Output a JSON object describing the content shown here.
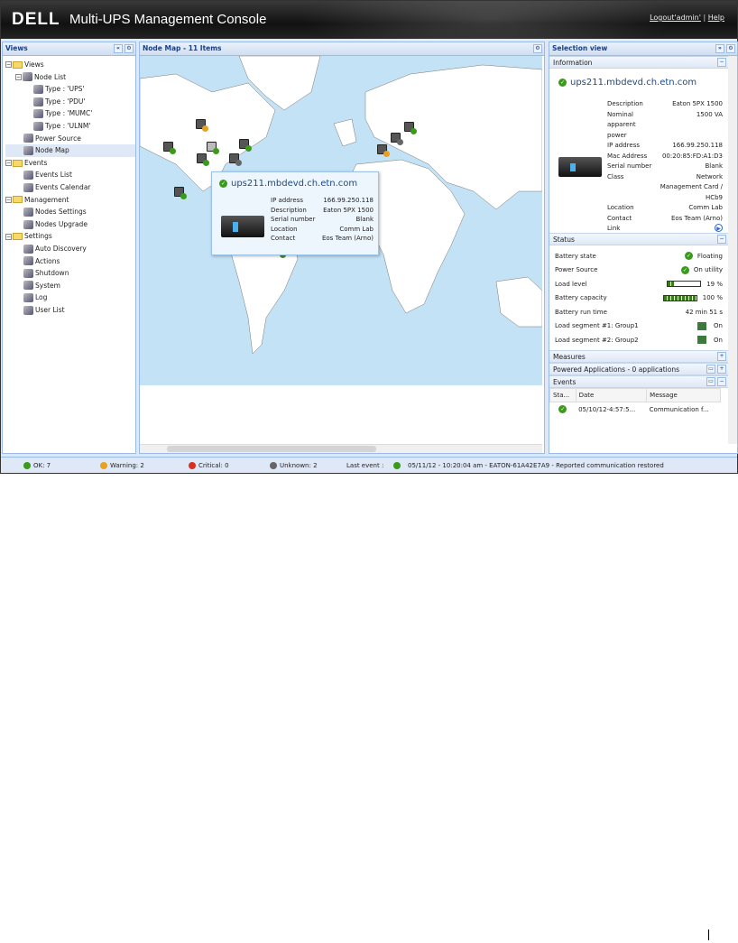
{
  "header": {
    "logo": "DELL",
    "title": "Multi-UPS Management Console",
    "logout": "Logout'admin'",
    "sep": "|",
    "help": "Help"
  },
  "views": {
    "title": "Views",
    "items": [
      {
        "label": "Views",
        "level": 0,
        "type": "folder"
      },
      {
        "label": "Node List",
        "level": 1,
        "type": "list"
      },
      {
        "label": "Type : 'UPS'",
        "level": 2
      },
      {
        "label": "Type : 'PDU'",
        "level": 2
      },
      {
        "label": "Type : 'MUMC'",
        "level": 2
      },
      {
        "label": "Type : 'ULNM'",
        "level": 2
      },
      {
        "label": "Power Source",
        "level": 1
      },
      {
        "label": "Node Map",
        "level": 1,
        "selected": true
      },
      {
        "label": "Events",
        "level": 0,
        "type": "folder"
      },
      {
        "label": "Events List",
        "level": 1
      },
      {
        "label": "Events Calendar",
        "level": 1
      },
      {
        "label": "Management",
        "level": 0,
        "type": "folder"
      },
      {
        "label": "Nodes Settings",
        "level": 1
      },
      {
        "label": "Nodes Upgrade",
        "level": 1
      },
      {
        "label": "Settings",
        "level": 0,
        "type": "folder"
      },
      {
        "label": "Auto Discovery",
        "level": 1
      },
      {
        "label": "Actions",
        "level": 1
      },
      {
        "label": "Shutdown",
        "level": 1
      },
      {
        "label": "System",
        "level": 1
      },
      {
        "label": "Log",
        "level": 1
      },
      {
        "label": "User List",
        "level": 1
      }
    ]
  },
  "map": {
    "title": "Node Map - 11 Items",
    "tooltip": {
      "host": "ups211.mbdevd.ch.etn.com",
      "fields": [
        [
          "IP address",
          "166.99.250.118"
        ],
        [
          "Description",
          "Eaton 5PX 1500"
        ],
        [
          "Serial number",
          "Blank"
        ],
        [
          "Location",
          "Comm Lab"
        ],
        [
          "Contact",
          "Eos Team (Arno)"
        ]
      ]
    }
  },
  "selection": {
    "title": "Selection view",
    "information": {
      "title": "Information",
      "host": "ups211.mbdevd.ch.etn.com",
      "fields": [
        [
          "Description",
          "Eaton 5PX 1500"
        ],
        [
          "Nominal apparent power",
          "1500 VA"
        ],
        [
          "IP address",
          "166.99.250.118"
        ],
        [
          "Mac Address",
          "00:20:85:FD:A1:D3"
        ],
        [
          "Serial number",
          "Blank"
        ],
        [
          "Class",
          "Network Management Card / HCb9"
        ],
        [
          "Location",
          "Comm Lab"
        ],
        [
          "Contact",
          "Eos Team (Arno)"
        ],
        [
          "Link",
          ""
        ]
      ]
    },
    "status": {
      "title": "Status",
      "rows": [
        {
          "label": "Battery state",
          "value": "Floating",
          "icon": "ok"
        },
        {
          "label": "Power Source",
          "value": "On utility",
          "icon": "ok"
        },
        {
          "label": "Load level",
          "value": "19 %",
          "bar": 0.19
        },
        {
          "label": "Battery capacity",
          "value": "100 %",
          "bar": 1.0
        },
        {
          "label": "Battery run time",
          "value": "42 min 51 s"
        },
        {
          "label": "Load segment #1: Group1",
          "value": "On",
          "icon": "outlet"
        },
        {
          "label": "Load segment #2: Group2",
          "value": "On",
          "icon": "outlet"
        }
      ]
    },
    "measures": "Measures",
    "powered": "Powered Applications - 0 applications",
    "events": {
      "title": "Events",
      "columns": [
        "Sta...",
        "Date",
        "Message"
      ],
      "rows": [
        [
          "ok",
          "05/10/12-4:57:5...",
          "Communication f..."
        ]
      ]
    }
  },
  "statusbar": {
    "ok": "OK: 7",
    "warning": "Warning: 2",
    "critical": "Critical: 0",
    "unknown": "Unknown: 2",
    "last_label": "Last event :",
    "last_event": "05/11/12 - 10:20:04 am - EATON-61A42E7A9 - Reported communication restored"
  },
  "colors": {
    "ok": "#3a9a1a",
    "warning": "#e8a020",
    "critical": "#d83020",
    "unknown": "#666666"
  }
}
